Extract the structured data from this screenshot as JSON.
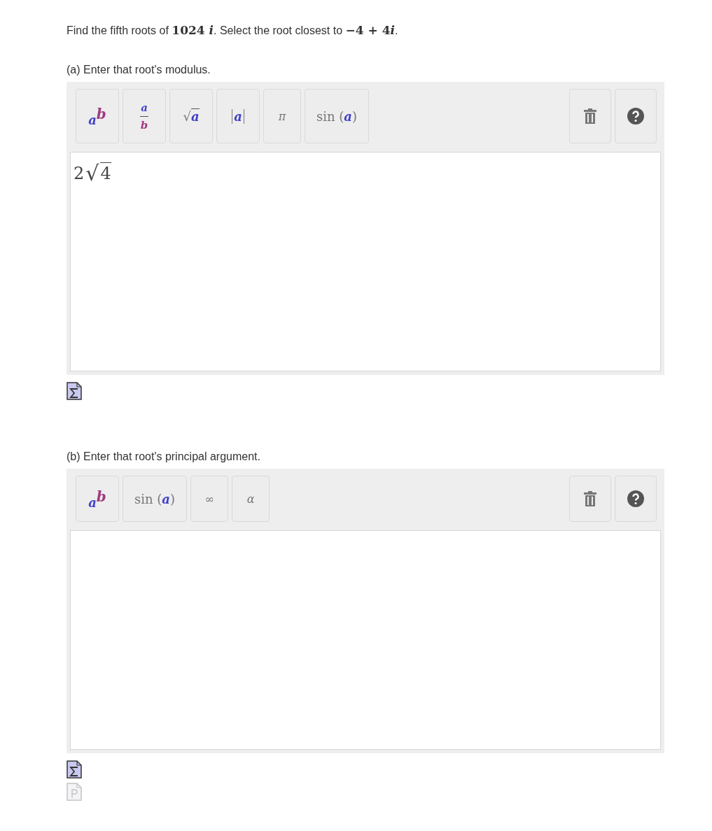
{
  "question": [
    {
      "kind": "text",
      "text": "Find the fifth roots of "
    },
    {
      "kind": "math",
      "text": "1024 "
    },
    {
      "kind": "math-italic",
      "text": "i"
    },
    {
      "kind": "text",
      "text": ". Select the root closest to "
    },
    {
      "kind": "math",
      "text": "−4 + 4"
    },
    {
      "kind": "math-italic",
      "text": "i"
    },
    {
      "kind": "text",
      "text": "."
    }
  ],
  "parts": [
    {
      "prompt": "(a) Enter that root's modulus.",
      "toolbar": [
        {
          "kind": "power",
          "base": "a",
          "exponent": "b"
        },
        {
          "kind": "fraction",
          "numerator": "a",
          "denominator": "b"
        },
        {
          "kind": "sqrt",
          "sign": "√",
          "radicand": "a"
        },
        {
          "kind": "abs",
          "content": "a"
        },
        {
          "kind": "symbol",
          "symbol": "π"
        },
        {
          "kind": "function",
          "name": "sin",
          "open": "(",
          "argument": "a",
          "close": ")"
        }
      ],
      "answer": {
        "coefficient": "2",
        "sign": "√",
        "radicand": "4"
      },
      "attachments": [
        {
          "kind": "formula",
          "disabled": false
        }
      ]
    },
    {
      "prompt": "(b) Enter that root's principal argument.",
      "toolbar": [
        {
          "kind": "power",
          "base": "a",
          "exponent": "b"
        },
        {
          "kind": "function",
          "name": "sin",
          "open": "(",
          "argument": "a",
          "close": ")"
        },
        {
          "kind": "symbol",
          "symbol": "∞"
        },
        {
          "kind": "symbol",
          "symbol": "α"
        }
      ],
      "attachments": [
        {
          "kind": "formula",
          "disabled": false
        },
        {
          "kind": "paragraph",
          "disabled": true
        }
      ]
    }
  ]
}
